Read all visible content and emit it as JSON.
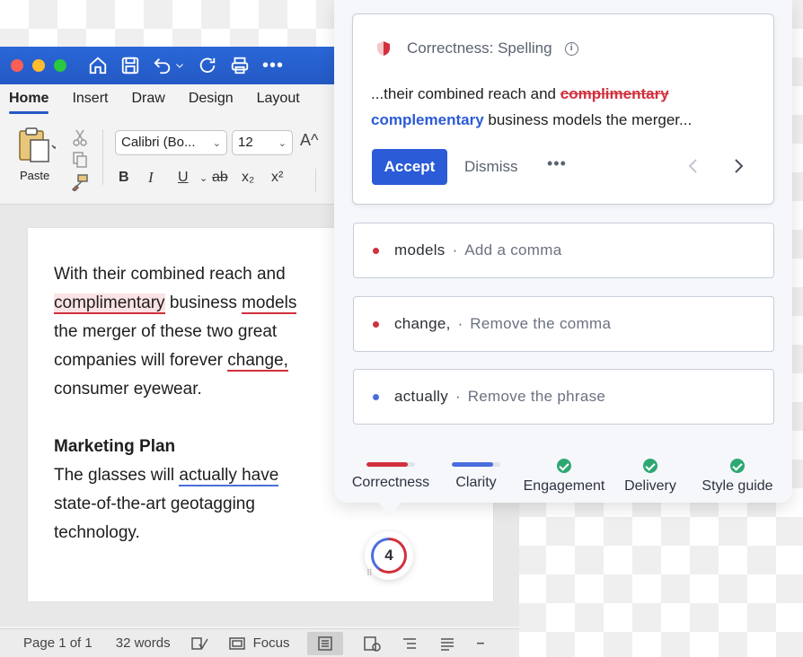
{
  "word": {
    "tabs": [
      "Home",
      "Insert",
      "Draw",
      "Design",
      "Layout"
    ],
    "active_tab": "Home",
    "paste_label": "Paste",
    "font_name": "Calibri (Bo...",
    "font_size": "12",
    "grow_font": "A^",
    "format_buttons": [
      "B",
      "I",
      "U",
      "ab",
      "x₂",
      "x²"
    ],
    "document": {
      "p1_a": "With their combined reach and ",
      "p1_err1": "complimentary",
      "p1_b": " business ",
      "p1_err2": "models",
      "p1_c": " the merger of these two great companies will forever ",
      "p1_err3": "change,",
      "p1_d": " consumer eyewear.",
      "heading": "Marketing Plan",
      "p2_a": "The glasses will ",
      "p2_err": "actually have",
      "p2_b": " state-of-the-art geotagging technology."
    },
    "status": {
      "page": "Page 1 of 1",
      "words": "32 words",
      "focus": "Focus"
    }
  },
  "grammarly": {
    "main_card": {
      "category": "Correctness: Spelling",
      "text_before": "...their combined reach and ",
      "wrong_word": "complimentary",
      "suggestion": "complementary",
      "text_after": " business models the merger...",
      "accept_label": "Accept",
      "dismiss_label": "Dismiss",
      "more_label": "•••"
    },
    "suggestions": [
      {
        "word": "models",
        "action": "Add a comma",
        "color": "#d1303d"
      },
      {
        "word": "change,",
        "action": "Remove the comma",
        "color": "#d1303d"
      },
      {
        "word": "actually",
        "action": "Remove the phrase",
        "color": "#4a6ddd"
      }
    ],
    "separator": "·",
    "categories": [
      {
        "label": "Correctness",
        "state": "bar",
        "color": "#d1303d",
        "fill": 0.85
      },
      {
        "label": "Clarity",
        "state": "bar",
        "color": "#4a6ddd",
        "fill": 0.85
      },
      {
        "label": "Engagement",
        "state": "check"
      },
      {
        "label": "Delivery",
        "state": "check"
      },
      {
        "label": "Style guide",
        "state": "check"
      }
    ],
    "badge_count": "4"
  }
}
